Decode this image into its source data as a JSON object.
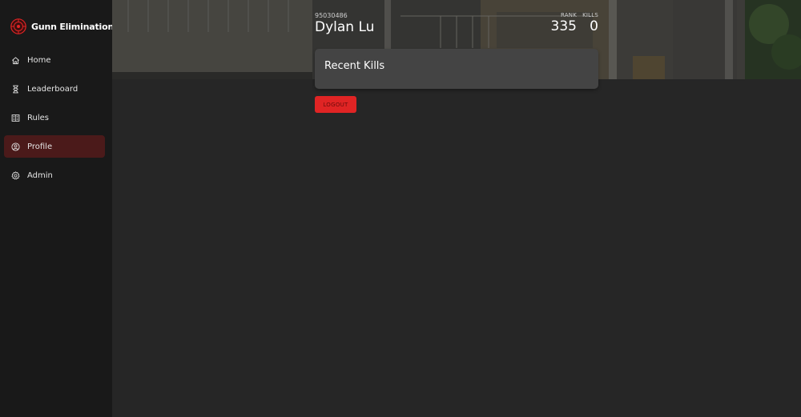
{
  "app": {
    "title": "Gunn Elimination",
    "accent_color": "#e02424",
    "logo_icon": "target-crosshair-icon"
  },
  "sidebar": {
    "items": [
      {
        "label": "Home",
        "icon": "home-icon",
        "active": false
      },
      {
        "label": "Leaderboard",
        "icon": "hourglass-icon",
        "active": false
      },
      {
        "label": "Rules",
        "icon": "rules-book-icon",
        "active": false
      },
      {
        "label": "Profile",
        "icon": "user-circle-icon",
        "active": true
      },
      {
        "label": "Admin",
        "icon": "gear-icon",
        "active": false
      }
    ]
  },
  "profile": {
    "id": "95030486",
    "name": "Dylan Lu",
    "rank_label": "RANK",
    "rank_value": "335",
    "kills_label": "KILLS",
    "kills_value": "0"
  },
  "recent_kills": {
    "title": "Recent Kills"
  },
  "actions": {
    "logout_label": "LOGOUT"
  }
}
